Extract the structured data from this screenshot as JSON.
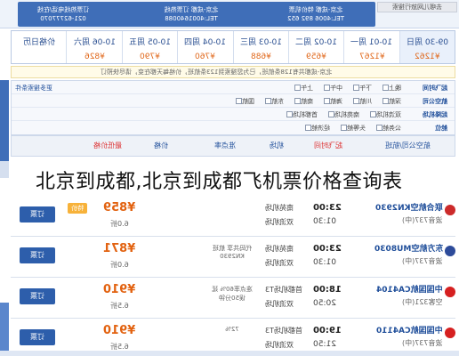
{
  "page_title": "北京到成都,北京到成都飞机票价格查询表",
  "banner": {
    "cells": [
      {
        "line1": "订票热线电话/在线",
        "line2": "021-62777070"
      },
      {
        "line1": "北京-成都 订票热线",
        "line2": "TEL:4001640088"
      },
      {
        "line1": "北京-成都 特价机票",
        "line2": "TEL:4006 892 652"
      }
    ],
    "right_label": "去哪儿网旅行搜索"
  },
  "dates": [
    {
      "date": "价格日历",
      "price": ""
    },
    {
      "date": "10-06 周六",
      "price": "¥826"
    },
    {
      "date": "10-05 周五",
      "price": "¥790"
    },
    {
      "date": "10-04 周四",
      "price": "¥760"
    },
    {
      "date": "10-03 周三",
      "price": "¥688"
    },
    {
      "date": "10-02 周二",
      "price": "¥659"
    },
    {
      "date": "10-01 周一",
      "price": "¥1267"
    },
    {
      "date": "09-30 周日",
      "price": "¥1262"
    }
  ],
  "notice": "北京-成都共有128条航班，已为您搜索到123条航班，价格每天都在变，请尽快预订",
  "filters": [
    {
      "label": "起飞时间",
      "left": "更多搜索条件",
      "options": [
        "上午",
        "中午",
        "下午",
        "晚上"
      ]
    },
    {
      "label": "航空公司",
      "left": "",
      "options": [
        "国航",
        "东航",
        "南航",
        "海航",
        "川航",
        "深航"
      ]
    },
    {
      "label": "起降机场",
      "left": "",
      "options": [
        "首都机场",
        "南苑机场",
        "双流机场"
      ]
    },
    {
      "label": "舱位",
      "left": "",
      "options": [
        "经济舱",
        "头等舱",
        "公务舱"
      ]
    }
  ],
  "table_header": {
    "airline": "航空公司/航班",
    "time": "起飞时间",
    "airport": "机场",
    "punctuality": "准点率",
    "cabin": "舱位",
    "price": "价格",
    "lowest": "最低价格"
  },
  "flights": [
    {
      "airline": "联合航空KN2930",
      "plane": "波音737(中)",
      "dep": "23:00",
      "arr": "01:30",
      "airport1": "南苑机场",
      "airport2": "双流机场",
      "info": "",
      "price": "¥859",
      "disc": "6.0折",
      "tag": "特价",
      "book": "订票",
      "logo_color": "#cc2a2a"
    },
    {
      "airline": "东方航空MU8030",
      "plane": "波音737(中)",
      "dep": "23:00",
      "arr": "01:30",
      "airport1": "南苑机场",
      "airport2": "双流机场",
      "info": "代码共享 航班KN2930",
      "price": "¥871",
      "disc": "6.0折",
      "tag": "",
      "book": "订票",
      "logo_color": "#2d4b9a"
    },
    {
      "airline": "中国国航CA4104",
      "plane": "空客321(中)",
      "dep": "18:00",
      "arr": "20:50",
      "airport1": "首都机场T3",
      "airport2": "双流机场",
      "info": "准点率60% 延误50分钟",
      "price": "¥910",
      "disc": "6.5折",
      "tag": "",
      "book": "订票",
      "logo_color": "#d62020"
    },
    {
      "airline": "中国国航CA4110",
      "plane": "波音737(中)",
      "dep": "19:00",
      "arr": "21:50",
      "airport1": "首都机场T3",
      "airport2": "双流机场",
      "info": "72%",
      "price": "¥910",
      "disc": "6.5折",
      "tag": "",
      "book": "订票",
      "logo_color": "#d62020"
    }
  ]
}
